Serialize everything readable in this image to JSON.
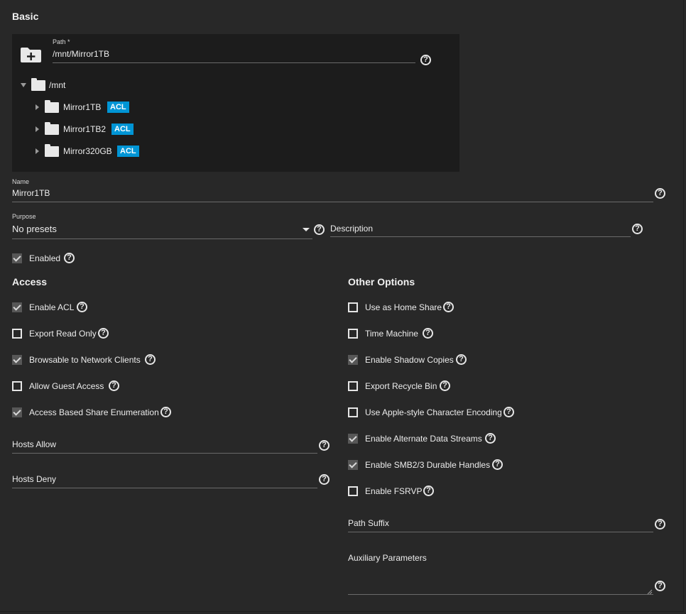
{
  "basic": {
    "title": "Basic",
    "path": {
      "label": "Path *",
      "value": "/mnt/Mirror1TB",
      "icon": "folder-add-icon",
      "tree": {
        "root": "/mnt",
        "children": [
          {
            "name": "Mirror1TB",
            "badge": "ACL"
          },
          {
            "name": "Mirror1TB2",
            "badge": "ACL"
          },
          {
            "name": "Mirror320GB",
            "badge": "ACL"
          }
        ]
      }
    },
    "name": {
      "label": "Name",
      "value": "Mirror1TB"
    },
    "purpose": {
      "label": "Purpose",
      "value": "No presets"
    },
    "description": {
      "placeholder": "Description"
    },
    "enabled": {
      "label": "Enabled",
      "checked": true
    }
  },
  "access": {
    "title": "Access",
    "options": [
      {
        "label": "Enable ACL",
        "checked": true
      },
      {
        "label": "Export Read Only",
        "checked": false
      },
      {
        "label": "Browsable to Network Clients",
        "checked": true
      },
      {
        "label": "Allow Guest Access",
        "checked": false
      },
      {
        "label": "Access Based Share Enumeration",
        "checked": true
      }
    ],
    "hosts_allow": {
      "placeholder": "Hosts Allow"
    },
    "hosts_deny": {
      "placeholder": "Hosts Deny"
    }
  },
  "other": {
    "title": "Other Options",
    "options": [
      {
        "label": "Use as Home Share",
        "checked": false
      },
      {
        "label": "Time Machine",
        "checked": false
      },
      {
        "label": "Enable Shadow Copies",
        "checked": true
      },
      {
        "label": "Export Recycle Bin",
        "checked": false
      },
      {
        "label": "Use Apple-style Character Encoding",
        "checked": false
      },
      {
        "label": "Enable Alternate Data Streams",
        "checked": true
      },
      {
        "label": "Enable SMB2/3 Durable Handles",
        "checked": true
      },
      {
        "label": "Enable FSRVP",
        "checked": false
      }
    ],
    "path_suffix": {
      "placeholder": "Path Suffix"
    },
    "aux_params": {
      "placeholder": "Auxiliary Parameters"
    }
  },
  "help_glyph": "?",
  "colors": {
    "accent": "#0095d5",
    "background": "#282828",
    "panel": "#1c1c1c"
  }
}
